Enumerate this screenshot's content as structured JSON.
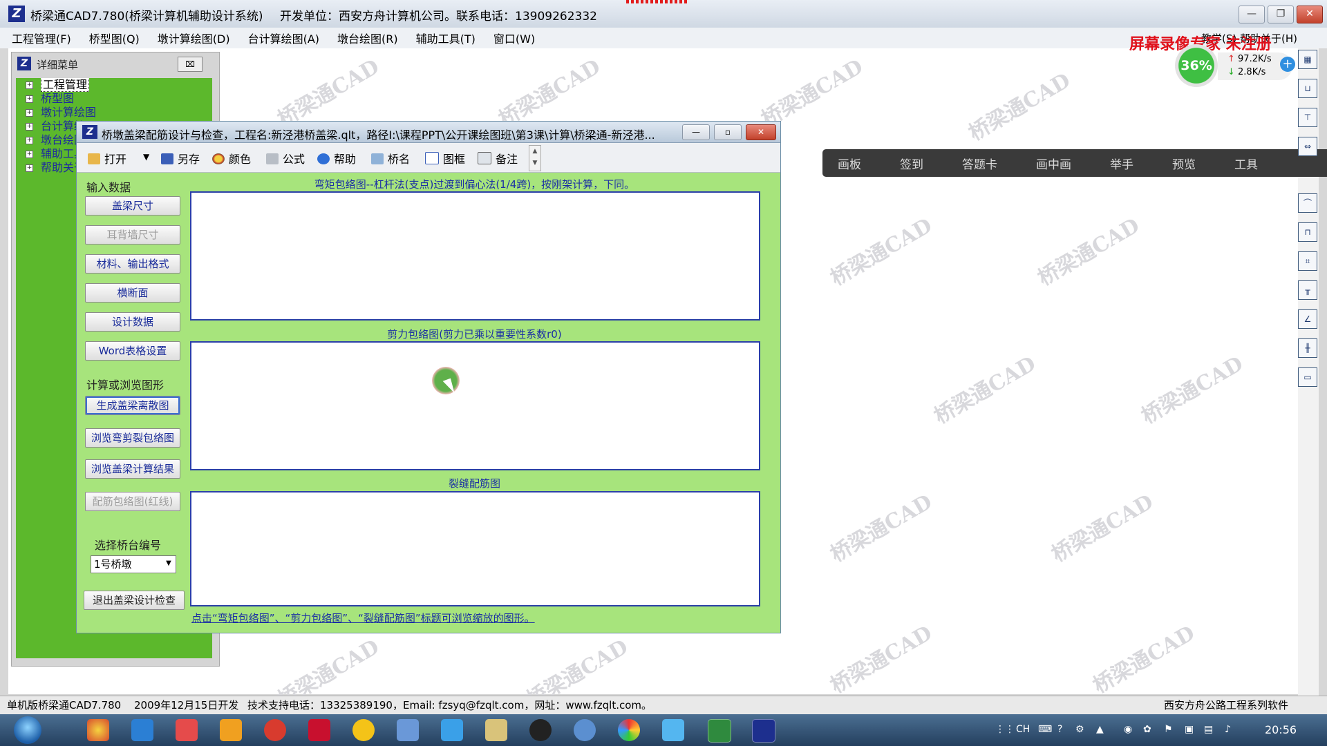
{
  "app": {
    "title": "桥梁通CAD7.780(桥梁计算机辅助设计系统)",
    "developer": "开发单位：西安方舟计算机公司。联系电话：13909262332",
    "window_controls": {
      "minimize": "—",
      "restore": "❐",
      "close": "✕"
    }
  },
  "menubar": {
    "items": [
      "工程管理(F)",
      "桥型图(Q)",
      "墩计算绘图(D)",
      "台计算绘图(A)",
      "墩台绘图(R)",
      "辅助工具(T)",
      "窗口(W)"
    ],
    "right": "教学(S)  帮助关于(H)"
  },
  "overlay": {
    "recorder_watermark": "屏幕录像专家 未注册",
    "watermark_text": "桥梁通CAD"
  },
  "speed": {
    "percent": "36%",
    "up": "97.2K/s",
    "down": "2.8K/s",
    "plus": "+"
  },
  "class_bar": {
    "items": [
      "画板",
      "签到",
      "答题卡",
      "画中画",
      "举手",
      "预览",
      "工具"
    ]
  },
  "detail_panel": {
    "title": "详细菜单",
    "close": "⌧",
    "tree": [
      {
        "label": "工程管理",
        "selected": true
      },
      {
        "label": "桥型图"
      },
      {
        "label": "墩计算绘图"
      },
      {
        "label": "台计算绘图"
      },
      {
        "label": "墩台绘图"
      },
      {
        "label": "辅助工具"
      },
      {
        "label": "帮助关于"
      }
    ]
  },
  "dialog": {
    "title": "桥墩盖梁配筋设计与检查，工程名:新泾港桥盖梁.qlt，路径I:\\课程PPT\\公开课绘图班\\第3课\\计算\\桥梁通-新泾港...",
    "controls": {
      "minimize": "—",
      "restore": "▫",
      "close": "✕"
    },
    "toolbar": {
      "open": "打开",
      "dropdown": "▼",
      "save_as": "另存",
      "color": "颜色",
      "formula": "公式",
      "help": "帮助",
      "bridge_name": "桥名",
      "frame": "图框",
      "note": "备注",
      "scroll_up": "▲",
      "scroll_down": "▼"
    },
    "input_section": "输入数据",
    "input_buttons": [
      "盖梁尺寸",
      "耳背墙尺寸",
      "材料、输出格式",
      "横断面",
      "设计数据",
      "Word表格设置"
    ],
    "calc_section": "计算或浏览图形",
    "calc_buttons": [
      "生成盖梁离散图",
      "浏览弯剪裂包络图",
      "浏览盖梁计算结果",
      "配筋包络图(红线)"
    ],
    "pier_label": "选择桥台编号",
    "pier_value": "1号桥墩",
    "pier_arrow": "▼",
    "exit_button": "退出盖梁设计检查",
    "panels": {
      "moment": "弯矩包络图--杠杆法(支点)过渡到偏心法(1/4跨)，按刚架计算，下同。",
      "shear": "剪力包络图(剪力已乘以重要性系数r0)",
      "crack": "裂缝配筋图"
    },
    "hint": "点击“弯矩包络图”、“剪力包络图”、“裂缝配筋图”标题可浏览缩放的图形。"
  },
  "statusbar": {
    "version": "单机版桥梁通CAD7.780",
    "date": "2009年12月15日开发",
    "support": "技术支持电话：13325389190，Email: fzsyq@fzqlt.com，网址：www.fzqlt.com。",
    "company": "西安方舟公路工程系列软件"
  },
  "taskbar": {
    "tray_lang": "CH",
    "clock": "20:56"
  }
}
